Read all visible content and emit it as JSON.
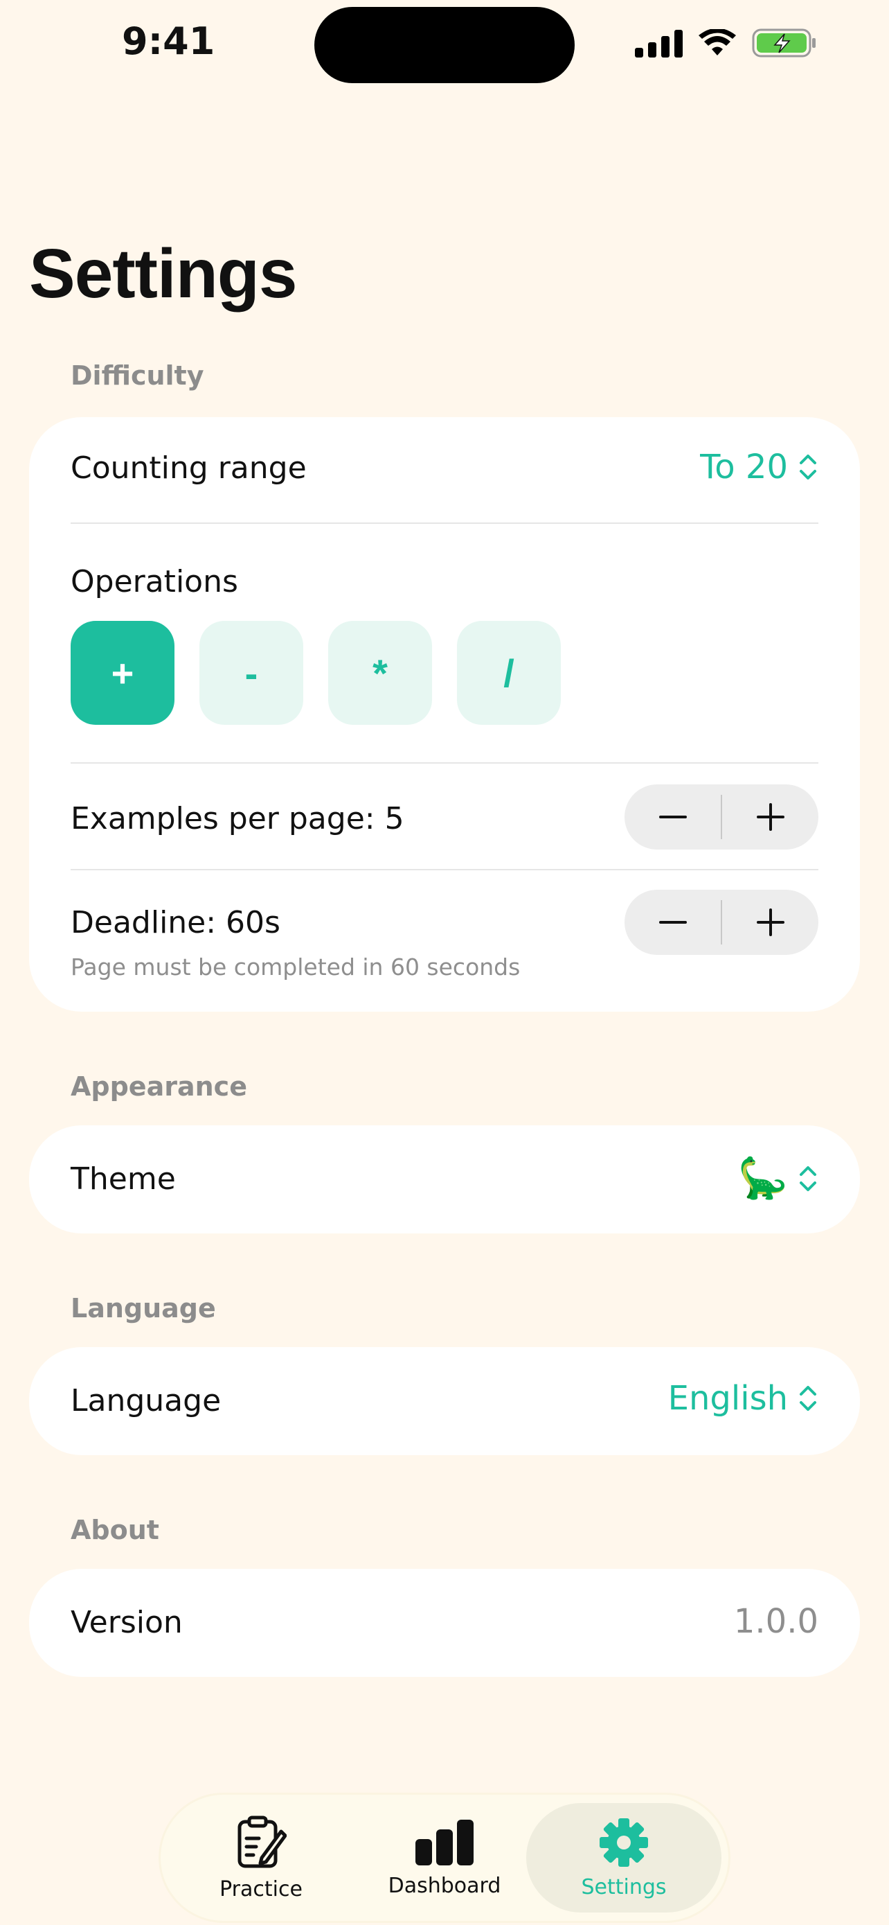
{
  "status_bar": {
    "time": "9:41"
  },
  "page": {
    "title": "Settings"
  },
  "sections": {
    "difficulty": {
      "label": "Difficulty",
      "counting_range": {
        "label": "Counting range",
        "value": "To 20"
      },
      "operations": {
        "label": "Operations",
        "items": [
          {
            "symbol": "+",
            "selected": true
          },
          {
            "symbol": "-",
            "selected": false
          },
          {
            "symbol": "*",
            "selected": false
          },
          {
            "symbol": "/",
            "selected": false
          }
        ]
      },
      "examples_per_page": {
        "label": "Examples per page: 5"
      },
      "deadline": {
        "label": "Deadline: 60s",
        "subtitle": "Page must be completed in 60 seconds"
      }
    },
    "appearance": {
      "label": "Appearance",
      "theme": {
        "label": "Theme",
        "value": "🦕"
      }
    },
    "language": {
      "label": "Language",
      "language": {
        "label": "Language",
        "value": "English"
      }
    },
    "about": {
      "label": "About",
      "version": {
        "label": "Version",
        "value": "1.0.0"
      }
    }
  },
  "tabs": [
    {
      "label": "Practice",
      "icon": "clipboard-pencil-icon",
      "active": false
    },
    {
      "label": "Dashboard",
      "icon": "bar-chart-icon",
      "active": false
    },
    {
      "label": "Settings",
      "icon": "gear-icon",
      "active": true
    }
  ],
  "colors": {
    "accent": "#1DBE9E",
    "background": "#FFF7EC",
    "card": "#FFFFFF"
  }
}
